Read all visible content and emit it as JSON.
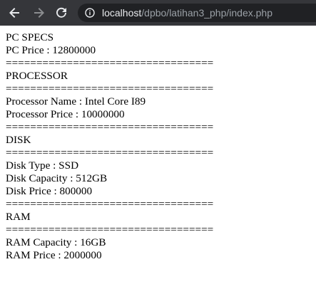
{
  "browser": {
    "url_host": "localhost",
    "url_path": "/dpbo/latihan3_php/index.php",
    "icons": {
      "back": "arrow-left-icon",
      "forward": "arrow-right-icon",
      "reload": "reload-icon",
      "site_info": "info-icon"
    }
  },
  "page": {
    "lines": [
      "PC SPECS",
      "PC Price : 12800000",
      "==================================",
      "PROCESSOR",
      "==================================",
      "Processor Name : Intel Core I89",
      "Processor Price : 10000000",
      "==================================",
      "DISK",
      "==================================",
      "Disk Type : SSD",
      "Disk Capacity : 512GB",
      "Disk Price : 800000",
      "==================================",
      "RAM",
      "==================================",
      "RAM Capacity : 16GB",
      "RAM Price : 2000000"
    ]
  }
}
